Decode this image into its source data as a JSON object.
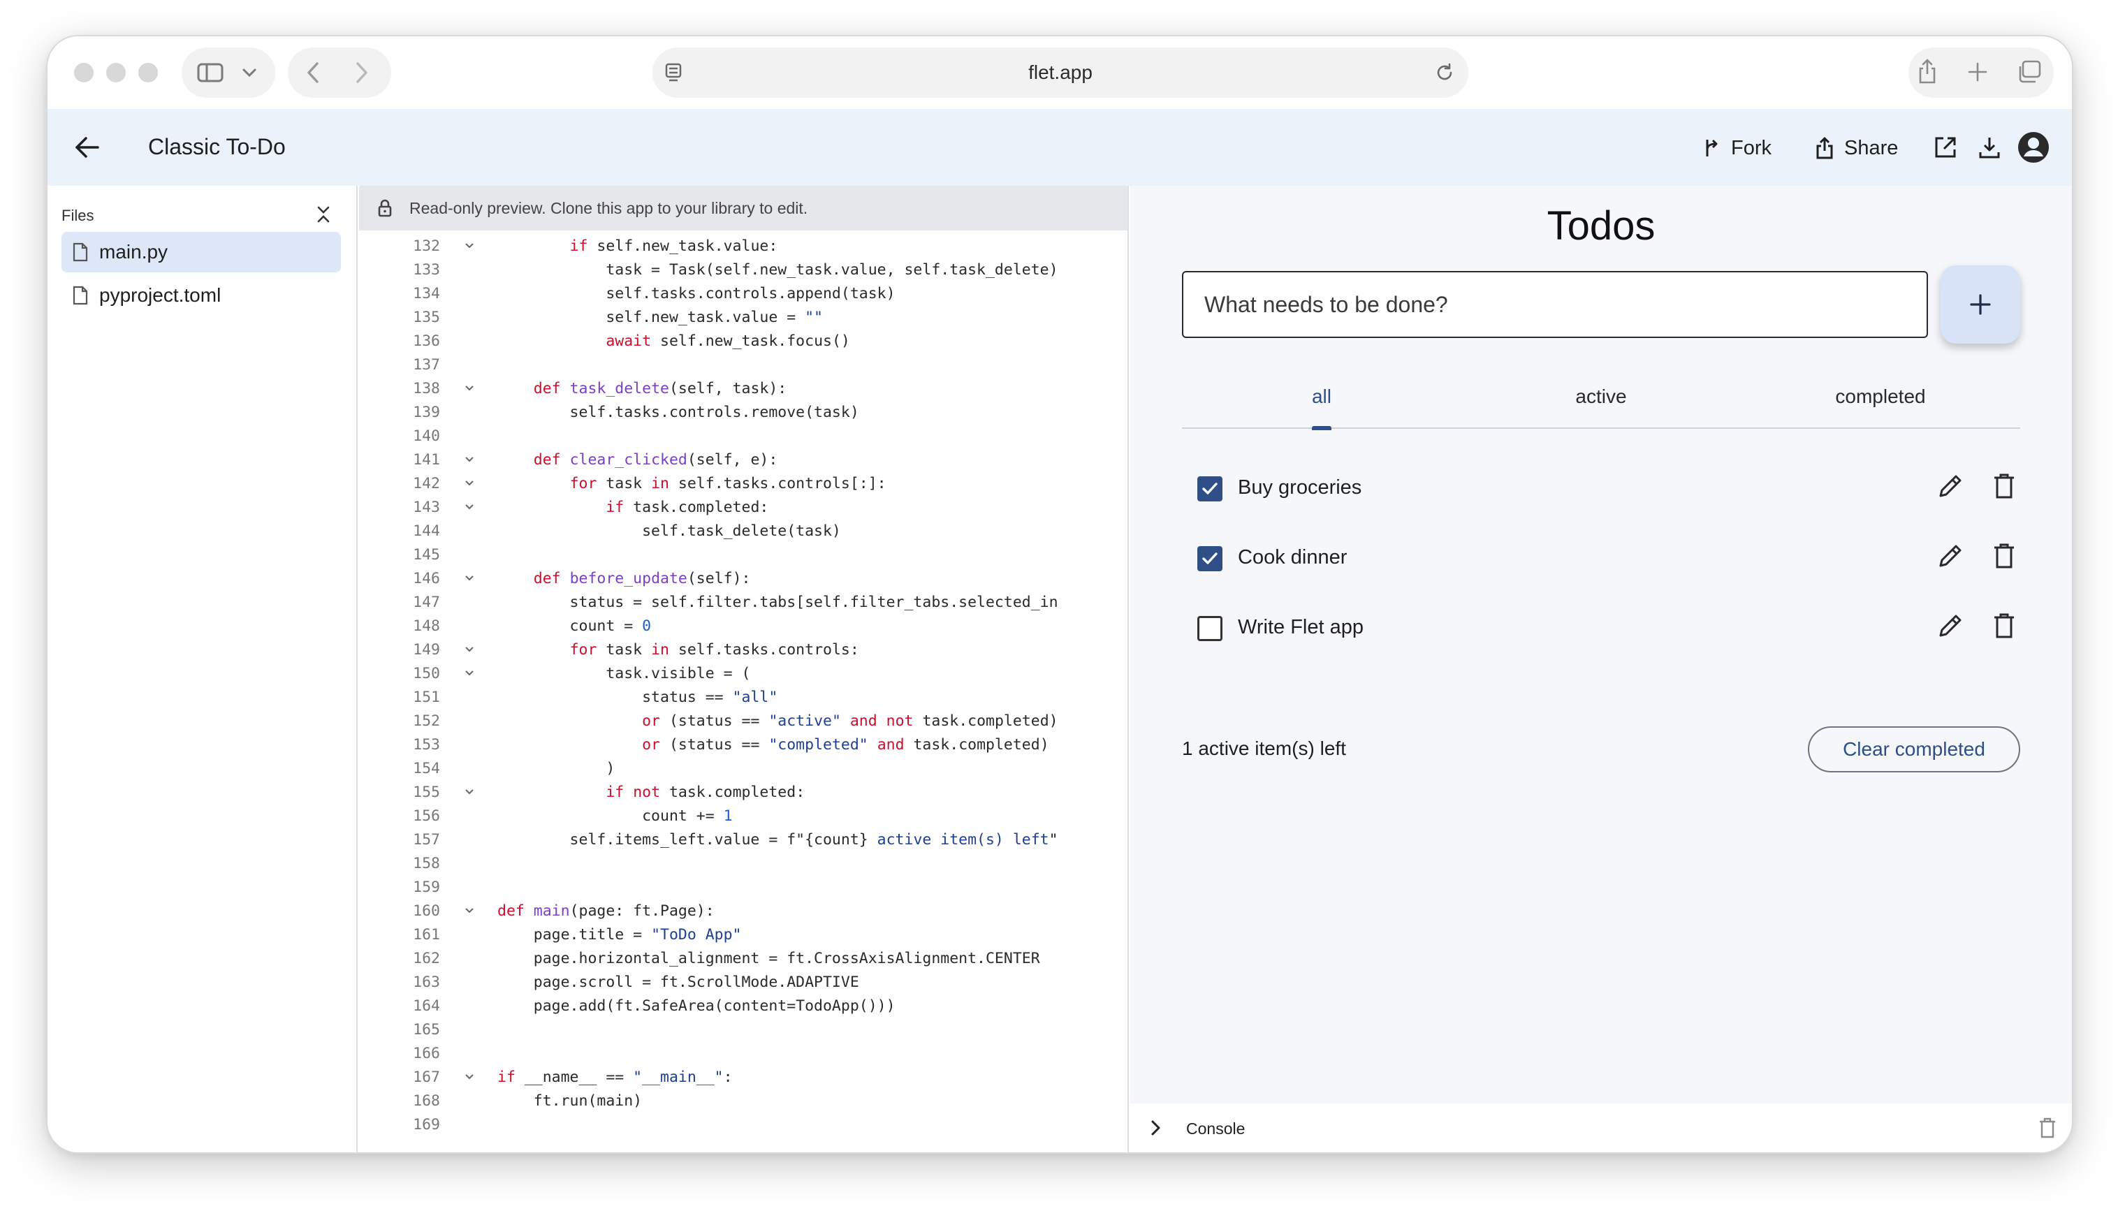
{
  "browser": {
    "url": "flet.app",
    "icons": [
      "sidebar-toggle-icon",
      "chevron-down-icon",
      "back-icon",
      "forward-icon",
      "page-icon",
      "reload-icon",
      "share-icon",
      "new-tab-icon",
      "tabs-overview-icon"
    ]
  },
  "app_bar": {
    "title": "Classic To-Do",
    "fork_label": "Fork",
    "share_label": "Share"
  },
  "sidebar": {
    "title": "Files",
    "files": [
      {
        "name": "main.py",
        "selected": true
      },
      {
        "name": "pyproject.toml",
        "selected": false
      }
    ]
  },
  "code": {
    "banner": "Read-only preview. Clone this app to your library to edit.",
    "lines": [
      {
        "n": "132",
        "fold": true,
        "code": "        if self.new_task.value:"
      },
      {
        "n": "133",
        "fold": false,
        "code": "            task = Task(self.new_task.value, self.task_delete)"
      },
      {
        "n": "134",
        "fold": false,
        "code": "            self.tasks.controls.append(task)"
      },
      {
        "n": "135",
        "fold": false,
        "code": "            self.new_task.value = \"\""
      },
      {
        "n": "136",
        "fold": false,
        "code": "            await self.new_task.focus()"
      },
      {
        "n": "137",
        "fold": false,
        "code": ""
      },
      {
        "n": "138",
        "fold": true,
        "code": "    def task_delete(self, task):"
      },
      {
        "n": "139",
        "fold": false,
        "code": "        self.tasks.controls.remove(task)"
      },
      {
        "n": "140",
        "fold": false,
        "code": ""
      },
      {
        "n": "141",
        "fold": true,
        "code": "    def clear_clicked(self, e):"
      },
      {
        "n": "142",
        "fold": true,
        "code": "        for task in self.tasks.controls[:]:"
      },
      {
        "n": "143",
        "fold": true,
        "code": "            if task.completed:"
      },
      {
        "n": "144",
        "fold": false,
        "code": "                self.task_delete(task)"
      },
      {
        "n": "145",
        "fold": false,
        "code": ""
      },
      {
        "n": "146",
        "fold": true,
        "code": "    def before_update(self):"
      },
      {
        "n": "147",
        "fold": false,
        "code": "        status = self.filter.tabs[self.filter_tabs.selected_in"
      },
      {
        "n": "148",
        "fold": false,
        "code": "        count = 0"
      },
      {
        "n": "149",
        "fold": true,
        "code": "        for task in self.tasks.controls:"
      },
      {
        "n": "150",
        "fold": true,
        "code": "            task.visible = ("
      },
      {
        "n": "151",
        "fold": false,
        "code": "                status == \"all\""
      },
      {
        "n": "152",
        "fold": false,
        "code": "                or (status == \"active\" and not task.completed)"
      },
      {
        "n": "153",
        "fold": false,
        "code": "                or (status == \"completed\" and task.completed)"
      },
      {
        "n": "154",
        "fold": false,
        "code": "            )"
      },
      {
        "n": "155",
        "fold": true,
        "code": "            if not task.completed:"
      },
      {
        "n": "156",
        "fold": false,
        "code": "                count += 1"
      },
      {
        "n": "157",
        "fold": false,
        "code": "        self.items_left.value = f\"{count} active item(s) left\""
      },
      {
        "n": "158",
        "fold": false,
        "code": ""
      },
      {
        "n": "159",
        "fold": false,
        "code": ""
      },
      {
        "n": "160",
        "fold": true,
        "code": "def main(page: ft.Page):"
      },
      {
        "n": "161",
        "fold": false,
        "code": "    page.title = \"ToDo App\""
      },
      {
        "n": "162",
        "fold": false,
        "code": "    page.horizontal_alignment = ft.CrossAxisAlignment.CENTER"
      },
      {
        "n": "163",
        "fold": false,
        "code": "    page.scroll = ft.ScrollMode.ADAPTIVE"
      },
      {
        "n": "164",
        "fold": false,
        "code": "    page.add(ft.SafeArea(content=TodoApp()))"
      },
      {
        "n": "165",
        "fold": false,
        "code": ""
      },
      {
        "n": "166",
        "fold": false,
        "code": ""
      },
      {
        "n": "167",
        "fold": true,
        "code": "if __name__ == \"__main__\":"
      },
      {
        "n": "168",
        "fold": false,
        "code": "    ft.run(main)"
      },
      {
        "n": "169",
        "fold": false,
        "code": ""
      }
    ]
  },
  "preview": {
    "title": "Todos",
    "input_placeholder": "What needs to be done?",
    "input_value": "",
    "tabs": [
      {
        "label": "all",
        "selected": true
      },
      {
        "label": "active",
        "selected": false
      },
      {
        "label": "completed",
        "selected": false
      }
    ],
    "todos": [
      {
        "label": "Buy groceries",
        "completed": true
      },
      {
        "label": "Cook dinner",
        "completed": true
      },
      {
        "label": "Write Flet app",
        "completed": false
      }
    ],
    "items_left": "1 active item(s) left",
    "clear_button": "Clear completed"
  },
  "console": {
    "label": "Console"
  },
  "colors": {
    "accent": "#2c4f8a",
    "app_bar_bg": "#ecf2fa",
    "preview_bg": "#f5f7fb",
    "keyword": "#c8102e",
    "function_name": "#7a3fc7",
    "string": "#1f3f8f",
    "number": "#1a5fcc"
  }
}
